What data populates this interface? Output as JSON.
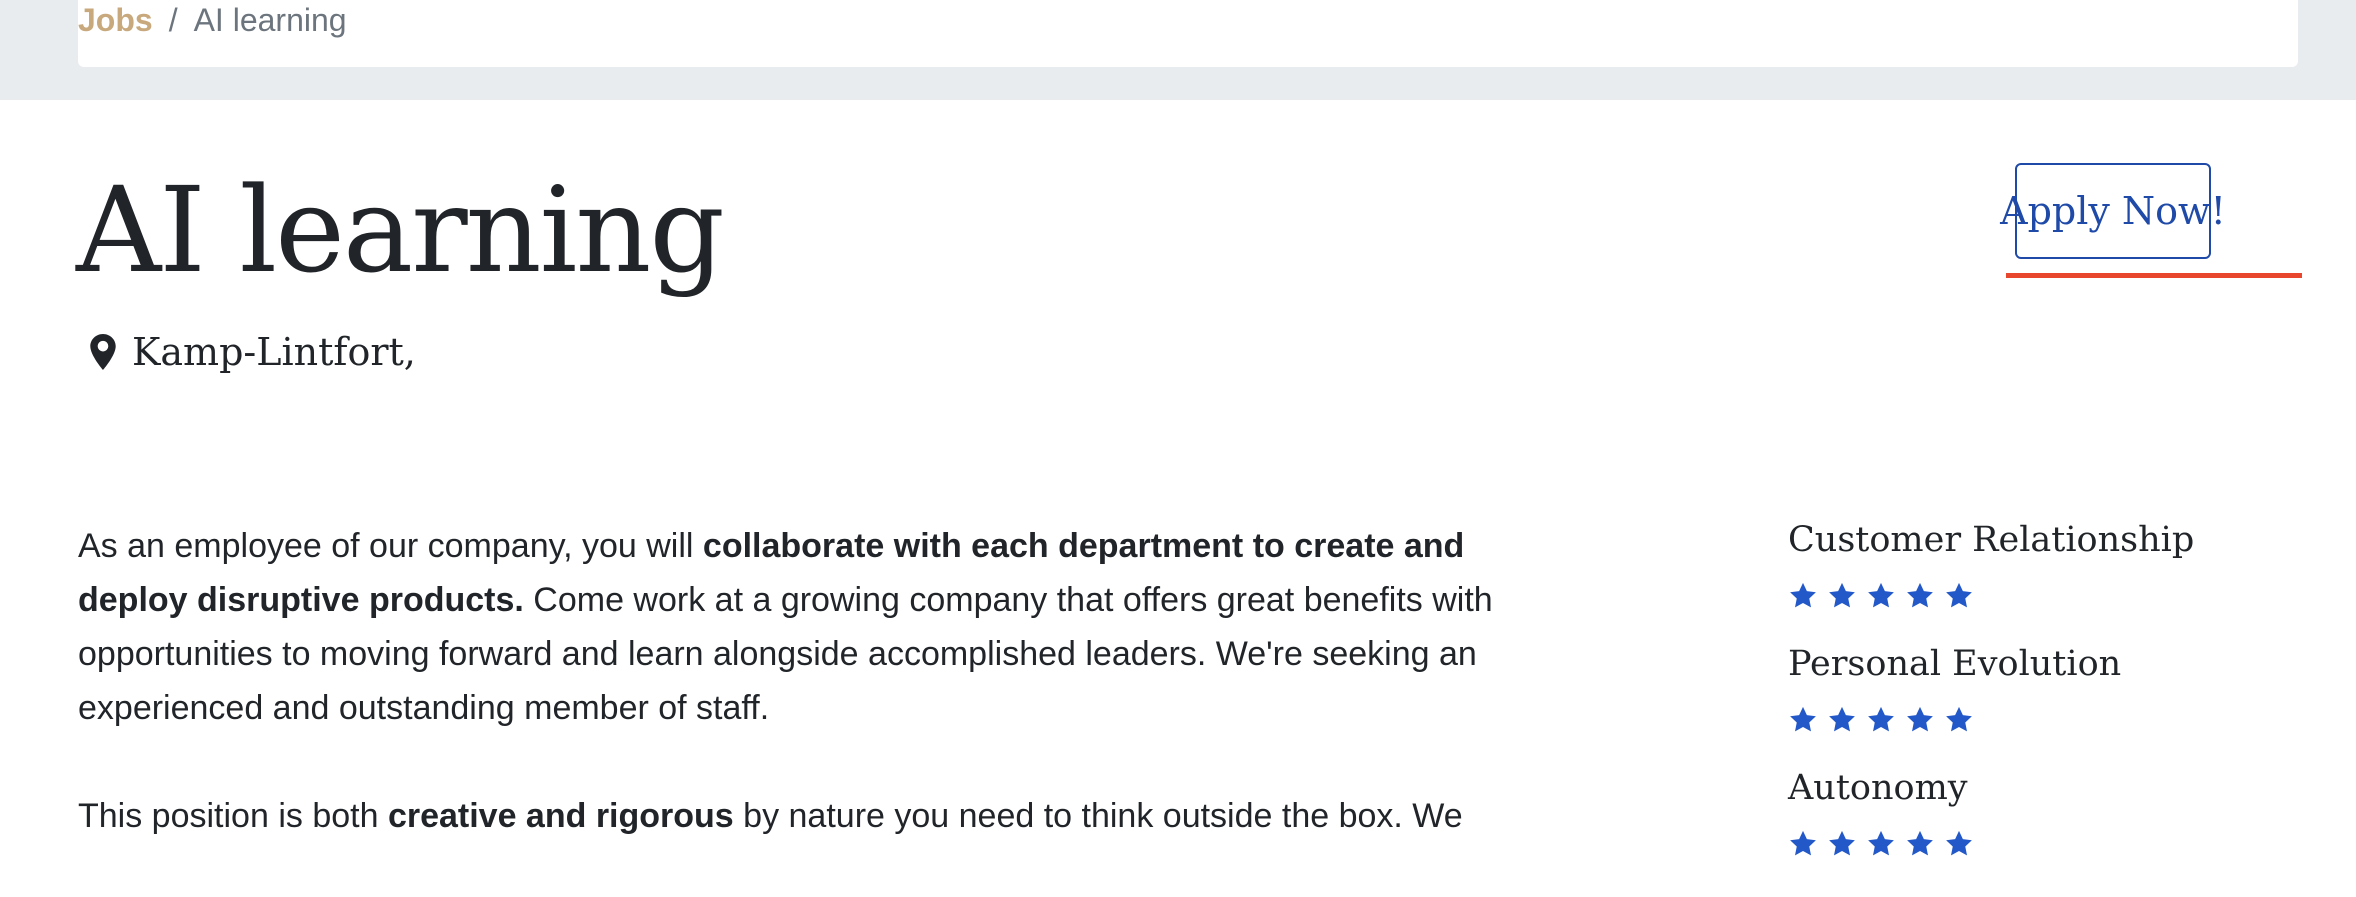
{
  "breadcrumb": {
    "link": "Jobs",
    "separator": "/",
    "current": "AI learning"
  },
  "job": {
    "title": "AI learning",
    "location": "Kamp-Lintfort,",
    "apply_label": "Apply Now!"
  },
  "description": {
    "p1_before": "As an employee of our company, you will ",
    "p1_bold": "collaborate with each department to create and deploy disruptive products.",
    "p1_after": " Come work at a growing company that offers great benefits with opportunities to moving forward and learn alongside accomplished leaders. We're seeking an experienced and outstanding member of staff.",
    "p2_before": "This position is both ",
    "p2_bold": "creative and rigorous",
    "p2_after": " by nature you need to think outside the box. We"
  },
  "ratings": [
    {
      "label": "Customer Relationship",
      "stars": 5
    },
    {
      "label": "Personal Evolution",
      "stars": 5
    },
    {
      "label": "Autonomy",
      "stars": 5
    }
  ],
  "colors": {
    "accent_link": "#c8a97e",
    "button_blue": "#1f4aa8",
    "star_blue": "#2358c8",
    "underline_red": "#e8472d",
    "band_gray": "#e9ecef"
  },
  "icons": {
    "location": "map-pin-icon",
    "rating": "star-icon"
  }
}
